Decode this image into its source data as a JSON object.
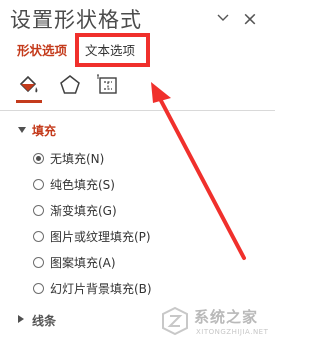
{
  "pane": {
    "title": "设置形状格式",
    "close_glyph": "×"
  },
  "tabs": [
    {
      "label": "形状选项",
      "active": true
    },
    {
      "label": "文本选项",
      "active": false
    }
  ],
  "category_icons": [
    "fill-line-bucket-icon",
    "effects-pentagon-icon",
    "size-properties-icon"
  ],
  "fill_section": {
    "title": "填充",
    "options": [
      {
        "label": "无填充(N)",
        "checked": true
      },
      {
        "label": "纯色填充(S)",
        "checked": false
      },
      {
        "label": "渐变填充(G)",
        "checked": false
      },
      {
        "label": "图片或纹理填充(P)",
        "checked": false
      },
      {
        "label": "图案填充(A)",
        "checked": false
      },
      {
        "label": "幻灯片背景填充(B)",
        "checked": false
      }
    ]
  },
  "line_section": {
    "title": "线条"
  },
  "annotation": {
    "color": "#f0302c"
  },
  "watermark": {
    "name": "系统之家",
    "url": "XITONGZHIJIA.NET"
  },
  "colors": {
    "accent": "#c43b1c",
    "annotation": "#f0302c"
  }
}
